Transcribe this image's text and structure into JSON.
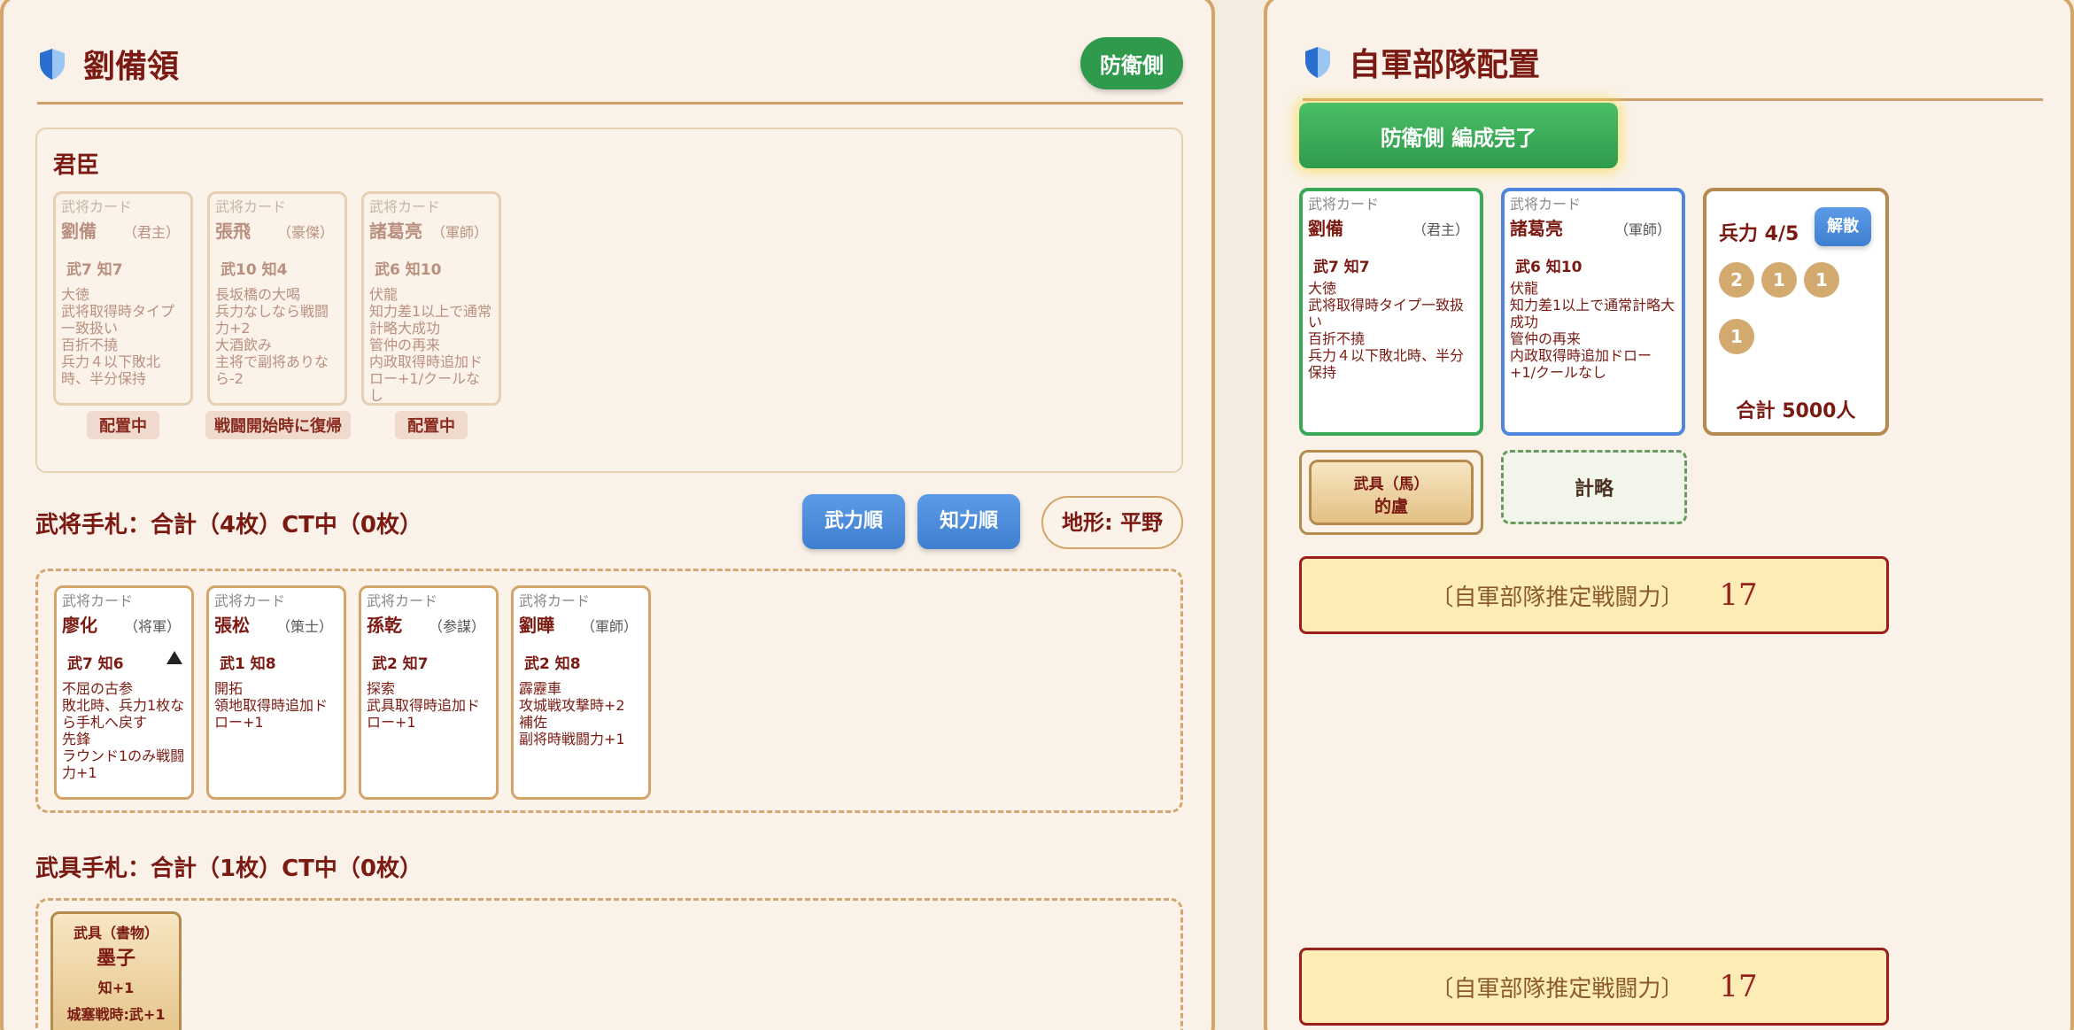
{
  "left": {
    "title": "劉備領",
    "role_badge": "防衛側",
    "retainers": {
      "label": "君臣",
      "cards": [
        {
          "header": "武将カード",
          "name": "劉備",
          "role": "（君主）",
          "stats": "武7 知7",
          "skills": "大徳\n武将取得時タイプ一致扱い\n百折不撓\n兵力４以下敗北時、半分保持",
          "status": "配置中"
        },
        {
          "header": "武将カード",
          "name": "張飛",
          "role": "（豪傑）",
          "stats": "武10 知4",
          "skills": "長坂橋の大喝\n兵力なしなら戦闘力+2\n大酒飲み\n主将で副将ありなら-2",
          "status": "戦闘開始時に復帰"
        },
        {
          "header": "武将カード",
          "name": "諸葛亮",
          "role": "（軍師）",
          "stats": "武6 知10",
          "skills": "伏龍\n知力差1以上で通常計略大成功\n管仲の再来\n内政取得時追加ドロー+1/クールなし",
          "status": "配置中"
        }
      ]
    },
    "hand": {
      "label": "武将手札：合計（4枚）CT中（0枚）",
      "sort_power": "武力順",
      "sort_intel": "知力順",
      "terrain": "地形: 平野",
      "cards": [
        {
          "header": "武将カード",
          "name": "廖化",
          "role": "（将軍）",
          "stats": "武7 知6",
          "skills": "不屈の古参\n敗北時、兵力1枚なら手札へ戻す\n先鋒\nラウンド1のみ戦闘力+1",
          "icon": "warning-triangle-icon"
        },
        {
          "header": "武将カード",
          "name": "張松",
          "role": "（策士）",
          "stats": "武1 知8",
          "skills": "開拓\n領地取得時追加ドロー+1"
        },
        {
          "header": "武将カード",
          "name": "孫乾",
          "role": "（参謀）",
          "stats": "武2 知7",
          "skills": "探索\n武具取得時追加ドロー+1"
        },
        {
          "header": "武将カード",
          "name": "劉曄",
          "role": "（軍師）",
          "stats": "武2 知8",
          "skills": "霹靂車\n攻城戦攻撃時+2\n補佐\n副将時戦闘力+1"
        }
      ]
    },
    "weapons": {
      "label": "武具手札：合計（1枚）CT中（0枚）",
      "cards": [
        {
          "type": "武具（書物）",
          "name": "墨子",
          "effect1": "知+1",
          "effect2": "城塞戦時:武+1"
        }
      ]
    }
  },
  "right": {
    "title": "自軍部隊配置",
    "complete_button": "防衛側 編成完了",
    "main_general": {
      "header": "武将カード",
      "name": "劉備",
      "role": "（君主）",
      "stats": "武7 知7",
      "skills": "大徳\n武将取得時タイプ一致扱い\n百折不撓\n兵力４以下敗北時、半分保持"
    },
    "sub_general": {
      "header": "武将カード",
      "name": "諸葛亮",
      "role": "（軍師）",
      "stats": "武6 知10",
      "skills": "伏龍\n知力差1以上で通常計略大成功\n管仲の再来\n内政取得時追加ドロー+1/クールなし"
    },
    "troops": {
      "label": "兵力 4/5",
      "disband": "解散",
      "coins": [
        "2",
        "1",
        "1",
        "1"
      ],
      "total": "合計 5000人"
    },
    "weapon_slot": {
      "type": "武具（馬）",
      "name": "的盧"
    },
    "strategy_slot": "計略",
    "power": {
      "label": "〔自軍部隊推定戦闘力〕",
      "value": "17"
    },
    "power_bottom": {
      "label": "〔自軍部隊推定戦闘力〕",
      "value": "17"
    }
  },
  "colors": {
    "accent_green": "#2f9a4c",
    "accent_blue": "#3f7fd0",
    "text_dark_red": "#7a1a12",
    "border_tan": "#d4a56a"
  }
}
